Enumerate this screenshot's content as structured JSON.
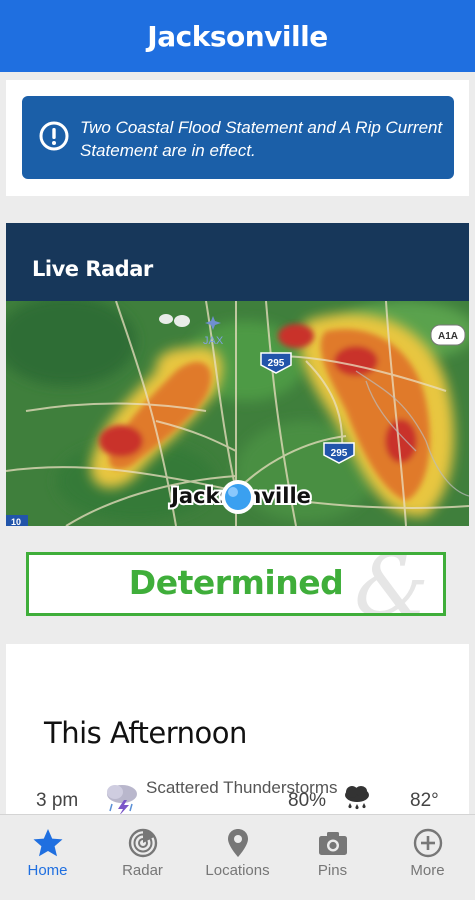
{
  "header": {
    "title": "Jacksonville"
  },
  "alert": {
    "text": "Two Coastal Flood Statement and  A Rip Current Statement are in effect."
  },
  "radar": {
    "title": "Live Radar",
    "map_labels": {
      "city": "Jacksonville",
      "airport": "JAX",
      "route_a1a": "A1A",
      "route_295a": "295",
      "route_295b": "295",
      "route_10": "10"
    }
  },
  "ad": {
    "text": "Determined",
    "amp": "&"
  },
  "forecast": {
    "title": "This Afternoon",
    "rows": [
      {
        "time": "3 pm",
        "condition": "Scattered Thunderstorms",
        "condition_icon": "thunderstorm-icon",
        "precip": "80%",
        "precip_icon": "rain-cloud-icon",
        "temp": "82°"
      }
    ]
  },
  "tabs": [
    {
      "label": "Home",
      "icon": "star-icon",
      "active": true
    },
    {
      "label": "Radar",
      "icon": "radar-icon",
      "active": false
    },
    {
      "label": "Locations",
      "icon": "location-pin-icon",
      "active": false
    },
    {
      "label": "Pins",
      "icon": "camera-icon",
      "active": false
    },
    {
      "label": "More",
      "icon": "plus-circle-icon",
      "active": false
    }
  ],
  "colors": {
    "header": "#1f6fe0",
    "alert": "#1b5fa8",
    "radar_header": "#17375a",
    "ad_green": "#3fae3a",
    "active_tab": "#1f6fe0"
  }
}
